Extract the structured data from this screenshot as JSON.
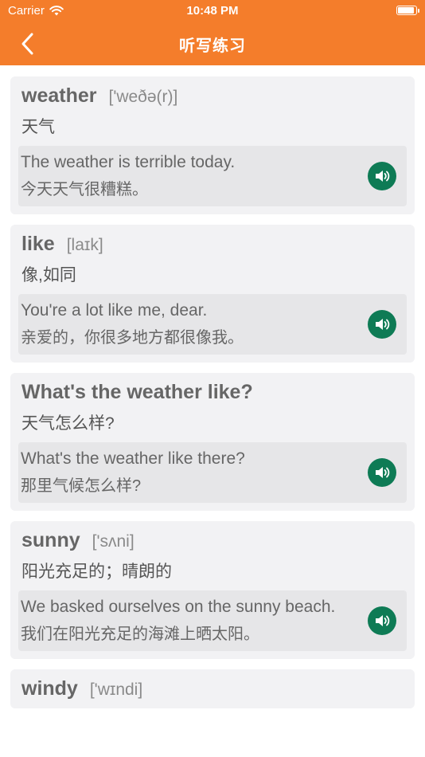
{
  "status": {
    "carrier": "Carrier",
    "time": "10:48 PM"
  },
  "nav": {
    "title": "听写练习"
  },
  "cards": [
    {
      "word": "weather",
      "phonetic": "['weðə(r)]",
      "meaning": "天气",
      "example_en": "The weather is terrible today.",
      "example_zh": "今天天气很糟糕。"
    },
    {
      "word": "like",
      "phonetic": "[laɪk]",
      "meaning": "像,如同",
      "example_en": "You're a lot like me, dear.",
      "example_zh": "亲爱的，你很多地方都很像我。"
    },
    {
      "word": "What's the weather like?",
      "phonetic": "",
      "meaning": "天气怎么样?",
      "example_en": "What's the weather like there?",
      "example_zh": "那里气候怎么样?"
    },
    {
      "word": "sunny",
      "phonetic": "['sʌni]",
      "meaning": "阳光充足的；晴朗的",
      "example_en": "We basked ourselves on the sunny beach.",
      "example_zh": "我们在阳光充足的海滩上晒太阳。"
    },
    {
      "word": "windy",
      "phonetic": "['wɪndi]",
      "meaning": "",
      "example_en": "",
      "example_zh": ""
    }
  ]
}
